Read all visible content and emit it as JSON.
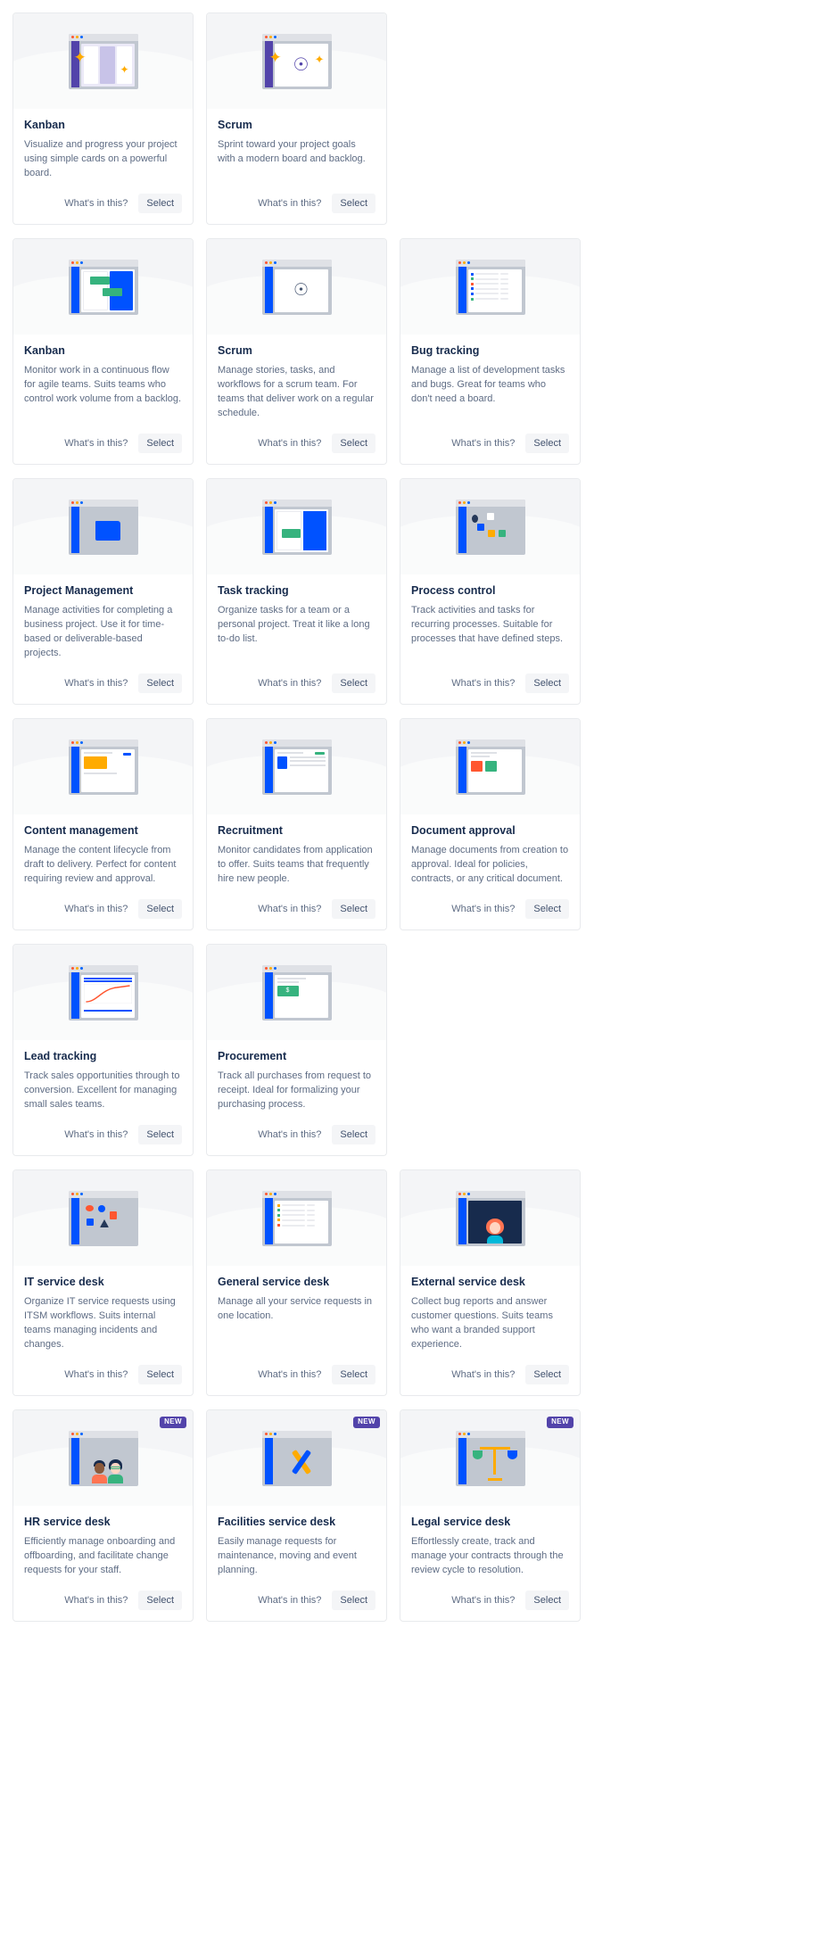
{
  "labels": {
    "whats_in_this": "What's in this?",
    "select": "Select",
    "new_badge": "NEW"
  },
  "colors": {
    "card_bg": "#ffffff",
    "card_border": "#e8eaed",
    "illustration_bg": "#f4f5f7",
    "title": "#172b4d",
    "description": "#5e6c84",
    "button_bg": "#f4f5f7",
    "badge_new_bg": "#5243aa",
    "accent_blue": "#0052ff",
    "accent_purple": "#5243aa",
    "accent_green": "#36b37e",
    "accent_red": "#ff5630",
    "accent_yellow": "#ffab00"
  },
  "rows": [
    {
      "cards": [
        {
          "title": "Kanban",
          "description": "Visualize and progress your project using simple cards on a powerful board.",
          "illustration": "kanban-purple-sparkles-illustration",
          "new": false
        },
        {
          "title": "Scrum",
          "description": "Sprint toward your project goals with a modern board and backlog.",
          "illustration": "scrum-sparkles-illustration",
          "new": false
        },
        null
      ]
    },
    {
      "cards": [
        {
          "title": "Kanban",
          "description": "Monitor work in a continuous flow for agile teams. Suits teams who control work volume from a backlog.",
          "illustration": "kanban-board-illustration",
          "new": false
        },
        {
          "title": "Scrum",
          "description": "Manage stories, tasks, and workflows for a scrum team. For teams that deliver work on a regular schedule.",
          "illustration": "scrum-board-illustration",
          "new": false
        },
        {
          "title": "Bug tracking",
          "description": "Manage a list of development tasks and bugs. Great for teams who don't need a board.",
          "illustration": "bug-list-illustration",
          "new": false
        }
      ]
    },
    {
      "cards": [
        {
          "title": "Project Management",
          "description": "Manage activities for completing a business project. Use it for time-based or deliverable-based projects.",
          "illustration": "folder-illustration",
          "new": false
        },
        {
          "title": "Task tracking",
          "description": "Organize tasks for a team or a personal project. Treat it like a long to-do list.",
          "illustration": "task-cards-illustration",
          "new": false
        },
        {
          "title": "Process control",
          "description": "Track activities and tasks for recurring processes. Suitable for processes that have defined steps.",
          "illustration": "workflow-nodes-illustration",
          "new": false
        }
      ]
    },
    {
      "cards": [
        {
          "title": "Content management",
          "description": "Manage the content lifecycle from draft to delivery. Perfect for content requiring review and approval.",
          "illustration": "content-image-doc-illustration",
          "new": false
        },
        {
          "title": "Recruitment",
          "description": "Monitor candidates from application to offer. Suits teams that frequently hire new people.",
          "illustration": "candidate-profile-illustration",
          "new": false
        },
        {
          "title": "Document approval",
          "description": "Manage documents from creation to approval. Ideal for policies, contracts, or any critical document.",
          "illustration": "approve-reject-doc-illustration",
          "new": false
        }
      ]
    },
    {
      "cards": [
        {
          "title": "Lead tracking",
          "description": "Track sales opportunities through to conversion. Excellent for managing small sales teams.",
          "illustration": "sales-chart-illustration",
          "new": false
        },
        {
          "title": "Procurement",
          "description": "Track all purchases from request to receipt. Ideal for formalizing your purchasing process.",
          "illustration": "money-invoice-illustration",
          "new": false
        },
        null
      ]
    },
    {
      "cards": [
        {
          "title": "IT service desk",
          "description": "Organize IT service requests using ITSM workflows. Suits internal teams managing incidents and changes.",
          "illustration": "itsm-diagram-illustration",
          "new": false
        },
        {
          "title": "General service desk",
          "description": "Manage all your service requests in one location.",
          "illustration": "request-list-illustration",
          "new": false
        },
        {
          "title": "External service desk",
          "description": "Collect bug reports and answer customer questions. Suits teams who want a branded support experience.",
          "illustration": "customer-avatar-illustration",
          "new": false
        }
      ]
    },
    {
      "cards": [
        {
          "title": "HR service desk",
          "description": "Efficiently manage onboarding and offboarding, and facilitate change requests for your staff.",
          "illustration": "two-people-illustration",
          "new": true
        },
        {
          "title": "Facilities service desk",
          "description": "Easily manage requests for maintenance, moving and event planning.",
          "illustration": "tools-wrench-illustration",
          "new": true
        },
        {
          "title": "Legal service desk",
          "description": "Effortlessly create, track and manage your contracts through the review cycle to resolution.",
          "illustration": "scales-of-justice-illustration",
          "new": true
        }
      ]
    }
  ]
}
